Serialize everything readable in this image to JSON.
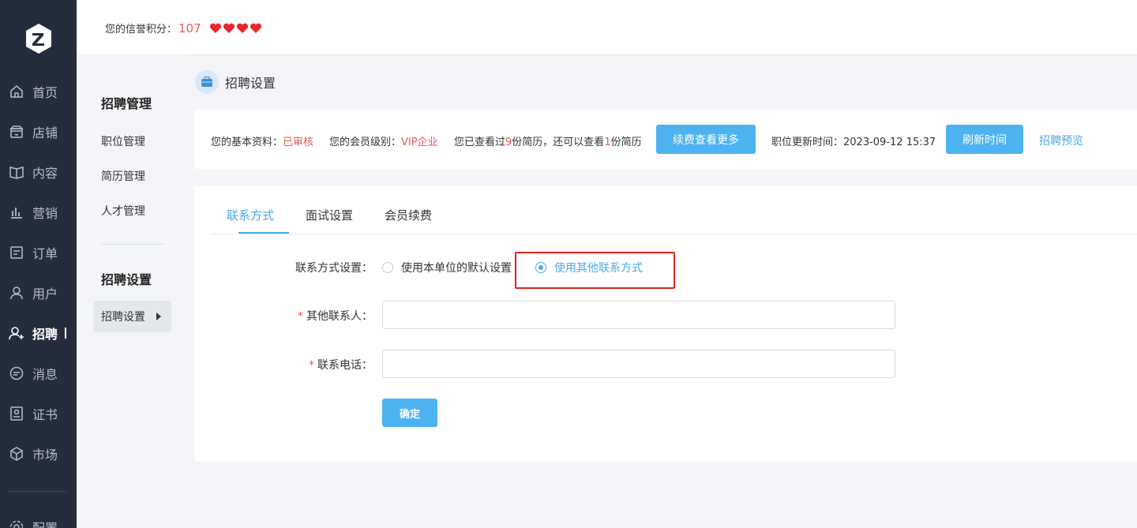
{
  "sidebar": {
    "items": [
      {
        "label": "首页",
        "icon": "home-icon"
      },
      {
        "label": "店铺",
        "icon": "store-icon"
      },
      {
        "label": "内容",
        "icon": "book-icon"
      },
      {
        "label": "营销",
        "icon": "bar-chart-icon"
      },
      {
        "label": "订单",
        "icon": "order-icon"
      },
      {
        "label": "用户",
        "icon": "user-icon"
      },
      {
        "label": "招聘",
        "icon": "recruit-icon",
        "active": true
      },
      {
        "label": "消息",
        "icon": "message-icon"
      },
      {
        "label": "证书",
        "icon": "certificate-icon"
      },
      {
        "label": "市场",
        "icon": "market-icon"
      }
    ],
    "bottom_item": {
      "label": "配置",
      "icon": "settings-icon"
    }
  },
  "header": {
    "credit_label": "您的信誉积分：",
    "credit_score": "107",
    "hearts": 4
  },
  "submenu": {
    "group1_title": "招聘管理",
    "group1_items": [
      "职位管理",
      "简历管理",
      "人才管理"
    ],
    "group2_title": "招聘设置",
    "group2_active": "招聘设置"
  },
  "page": {
    "title": "招聘设置"
  },
  "info": {
    "basic_label": "您的基本资料：",
    "basic_status": "已审核",
    "level_label": "您的会员级别：",
    "level_value": "VIP企业",
    "viewed_prefix": "您已查看过",
    "viewed_count": "9",
    "viewed_mid": "份简历，还可以查看",
    "remain_count": "1",
    "viewed_suffix": "份简历",
    "renew_button": "续费查看更多",
    "update_label": "职位更新时间：",
    "update_time": "2023-09-12 15:37",
    "refresh_button": "刷新时间",
    "preview_link": "招聘预览"
  },
  "tabs": [
    {
      "label": "联系方式",
      "active": true
    },
    {
      "label": "面试设置"
    },
    {
      "label": "会员续费"
    }
  ],
  "form": {
    "contact_setting_label": "联系方式设置：",
    "option_default": "使用本单位的默认设置",
    "option_other": "使用其他联系方式",
    "selected": "option_other",
    "contact_person_label": "其他联系人：",
    "contact_person_value": "",
    "phone_label": "联系电话：",
    "phone_value": "",
    "required_mark": "*",
    "confirm_button": "确定"
  },
  "colors": {
    "sidebar_bg": "#232d3c",
    "accent": "#4db3f0",
    "link": "#4aa8e8",
    "warning": "#e85a4f",
    "highlight": "#e0231a"
  }
}
